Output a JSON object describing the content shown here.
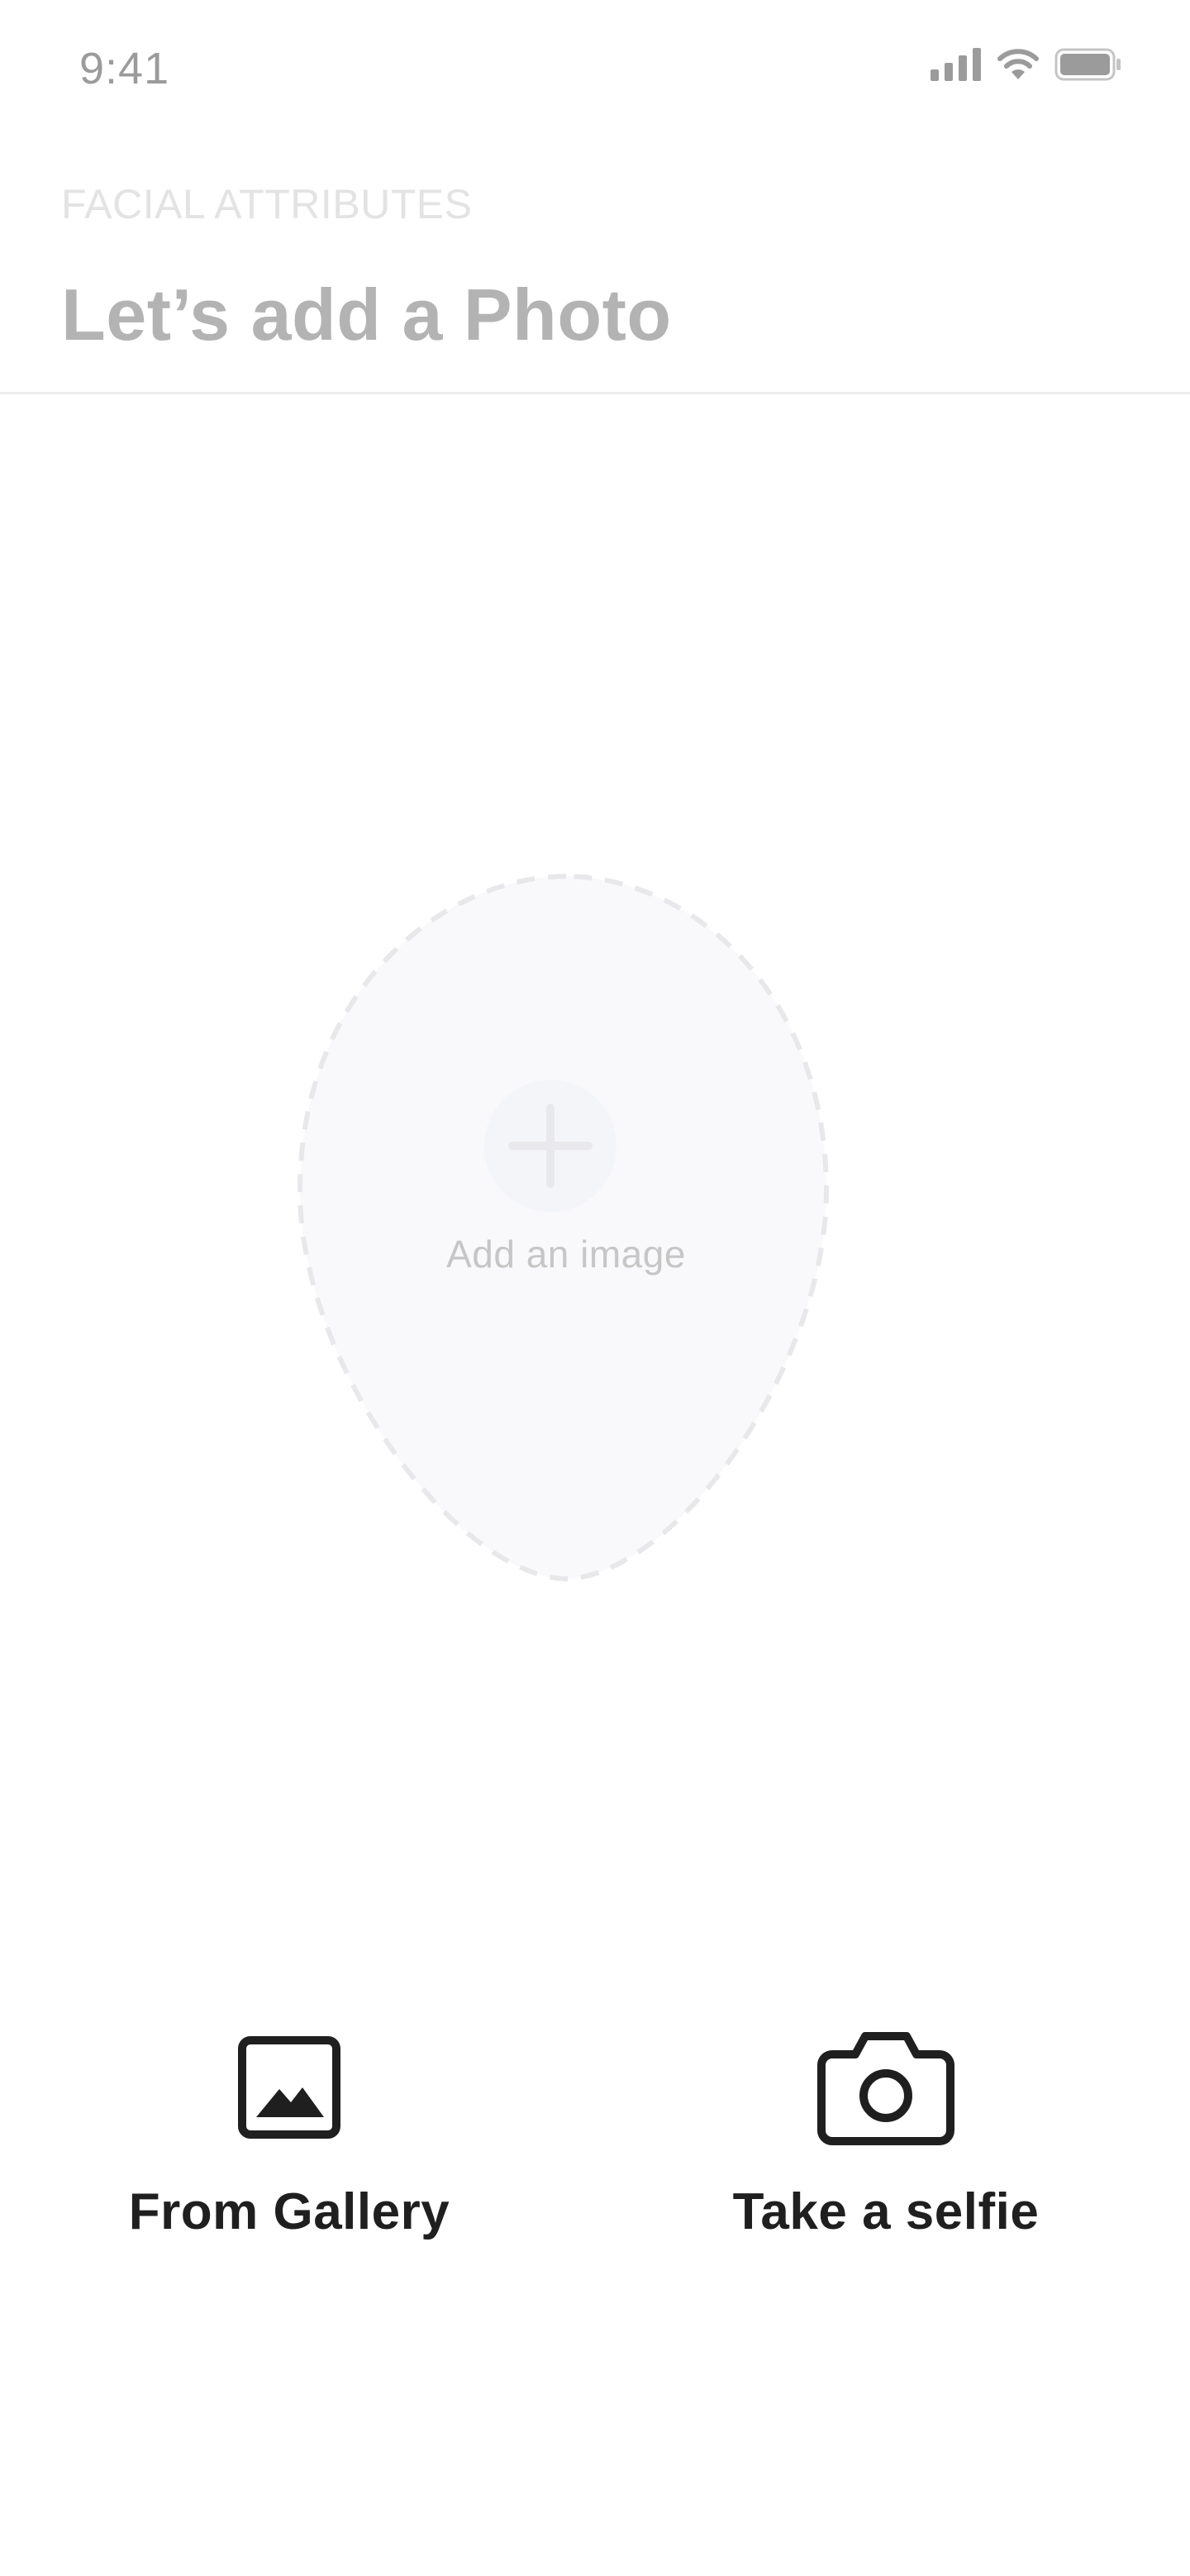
{
  "status_bar": {
    "time": "9:41",
    "icons": [
      "cellular-signal-icon",
      "wifi-icon",
      "battery-icon"
    ]
  },
  "header": {
    "overline": "FACIAL ATTRIBUTES",
    "title": "Let’s add a Photo"
  },
  "upload": {
    "icon": "plus-icon",
    "label": "Add an image"
  },
  "actions": {
    "gallery": {
      "icon": "image-icon",
      "label": "From Gallery"
    },
    "selfie": {
      "icon": "camera-icon",
      "label": "Take a selfie"
    }
  },
  "colors": {
    "title": "#b3b3b3",
    "overline": "#e3e3e3",
    "upload_fill": "#f9f9fb",
    "upload_dash": "#e8e8ea",
    "action_text": "#1f1f1f"
  }
}
